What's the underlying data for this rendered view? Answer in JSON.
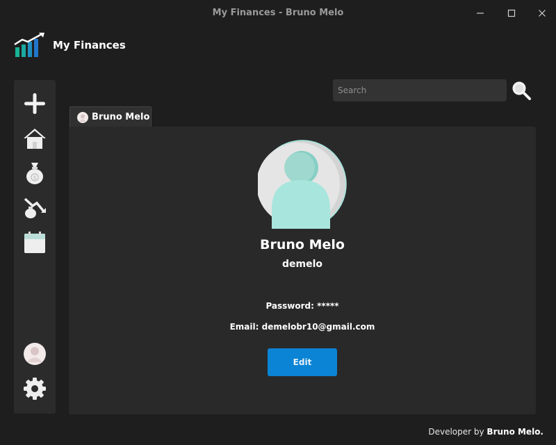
{
  "window": {
    "title": "My Finances - Bruno Melo",
    "minimize_icon": "minimize-icon",
    "maximize_icon": "maximize-icon",
    "close_icon": "close-icon"
  },
  "brand": {
    "name": "My Finances",
    "icon": "finance-chart-logo"
  },
  "sidebar": {
    "items": [
      {
        "icon": "plus-icon"
      },
      {
        "icon": "home-icon"
      },
      {
        "icon": "money-bag-icon"
      },
      {
        "icon": "expense-icon"
      },
      {
        "icon": "calendar-icon"
      },
      {
        "icon": "user-avatar-icon"
      },
      {
        "icon": "gear-icon"
      }
    ]
  },
  "search": {
    "placeholder": "Search",
    "value": "",
    "icon": "search-icon"
  },
  "tabs": [
    {
      "label": "Bruno Melo",
      "icon": "user-avatar-icon"
    }
  ],
  "profile": {
    "full_name": "Bruno Melo",
    "username": "demelo",
    "password_label": "Password:",
    "password_value": "*****",
    "email_label": "Email:",
    "email_value": "demelobr10@gmail.com",
    "edit_label": "Edit"
  },
  "footer": {
    "prefix": "Developer by",
    "author": "Bruno Melo."
  },
  "colors": {
    "background": "#1e1e1f",
    "panel": "#29292a",
    "sidebar": "#2b2b2c",
    "accent": "#0b84d5",
    "avatar_teal": "#a3e6de"
  }
}
